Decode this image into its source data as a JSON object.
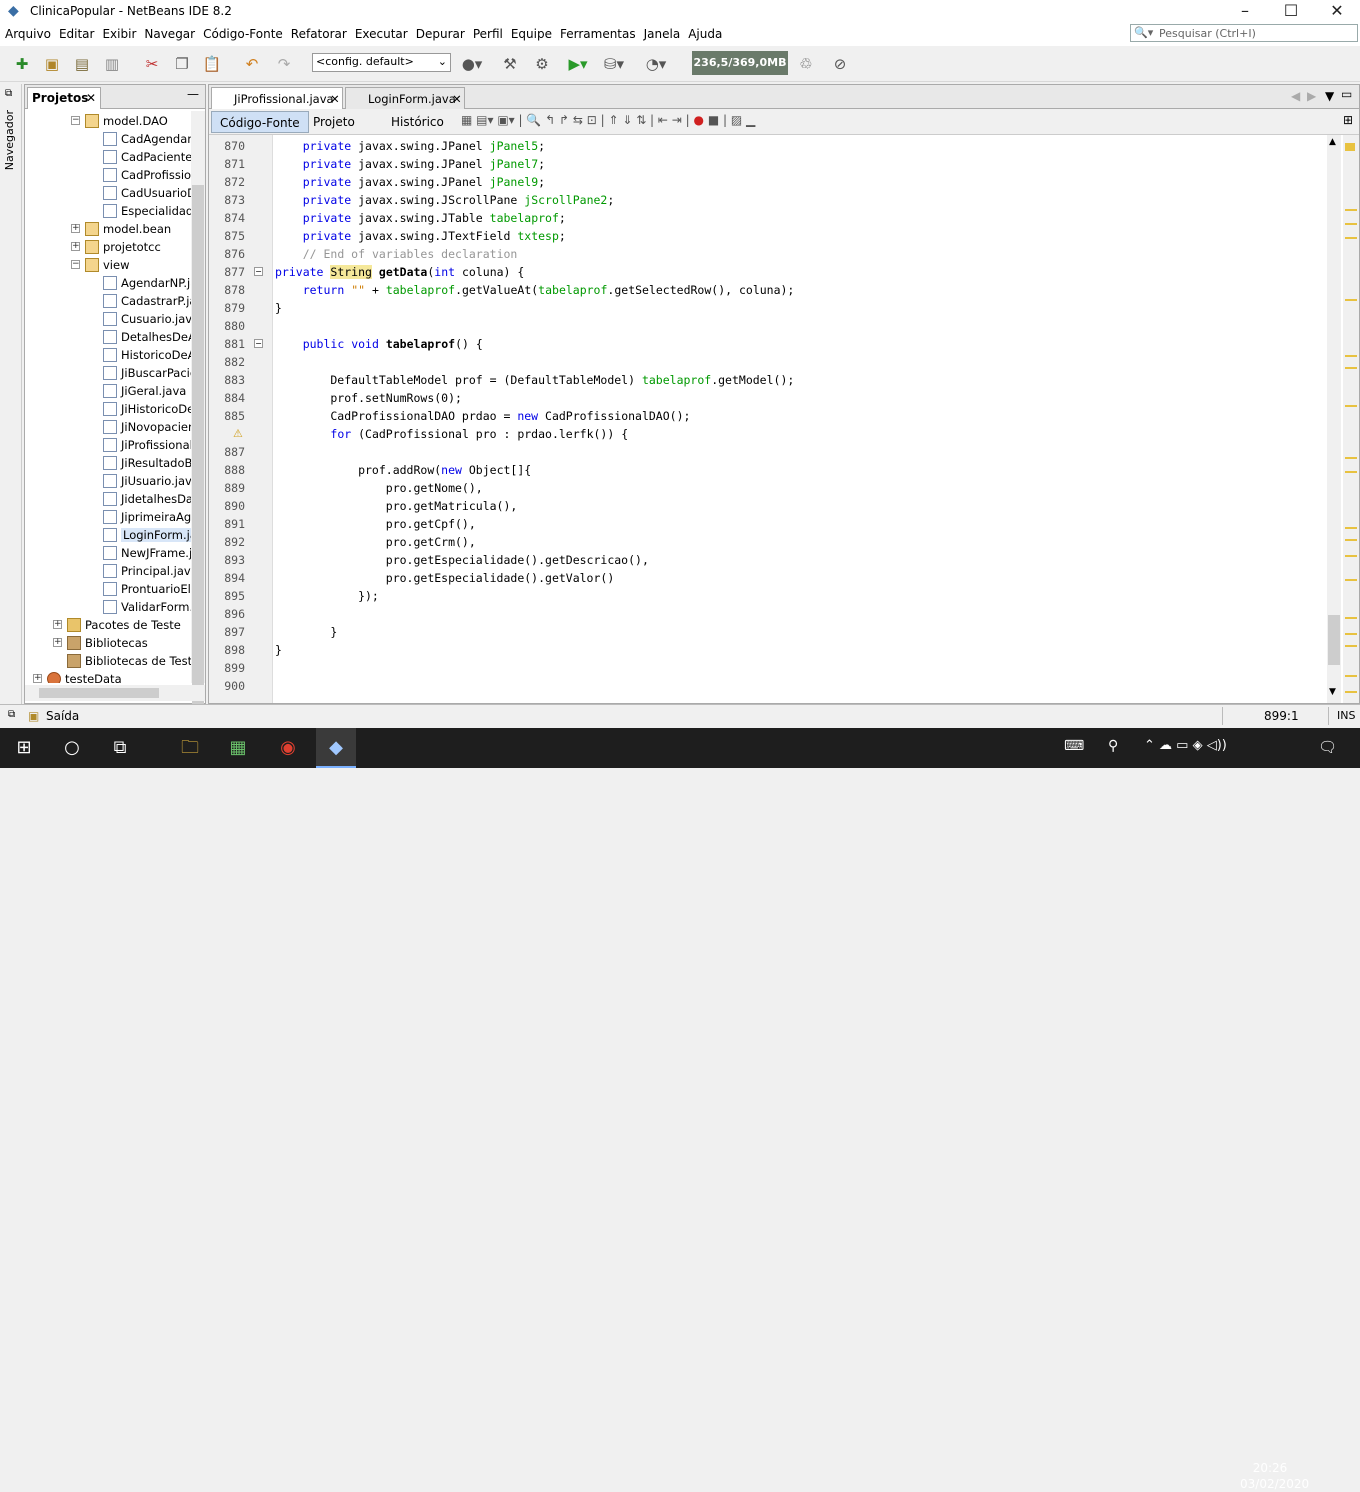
{
  "window": {
    "title": "ClinicaPopular - NetBeans IDE 8.2"
  },
  "menu": [
    "Arquivo",
    "Editar",
    "Exibir",
    "Navegar",
    "Código-Fonte",
    "Refatorar",
    "Executar",
    "Depurar",
    "Perfil",
    "Equipe",
    "Ferramentas",
    "Janela",
    "Ajuda"
  ],
  "search": {
    "placeholder": "Pesquisar (Ctrl+I)"
  },
  "toolbar": {
    "config": "<config. default>",
    "memory": "236,5/369,0MB"
  },
  "navigator": {
    "label": "Navegador"
  },
  "projects": {
    "tab": "Projetos",
    "tree": [
      {
        "label": "model.DAO",
        "icon": "pkg",
        "depth": 2,
        "exp": "-"
      },
      {
        "label": "CadAgendam",
        "icon": "java",
        "depth": 3
      },
      {
        "label": "CadPacienteD",
        "icon": "java",
        "depth": 3
      },
      {
        "label": "CadProfissior",
        "icon": "java",
        "depth": 3
      },
      {
        "label": "CadUsuarioD",
        "icon": "java",
        "depth": 3
      },
      {
        "label": "Especialidade",
        "icon": "java",
        "depth": 3
      },
      {
        "label": "model.bean",
        "icon": "pkg",
        "depth": 2,
        "exp": "+"
      },
      {
        "label": "projetotcc",
        "icon": "pkg",
        "depth": 2,
        "exp": "+"
      },
      {
        "label": "view",
        "icon": "pkg",
        "depth": 2,
        "exp": "-"
      },
      {
        "label": "AgendarNP.ja",
        "icon": "java",
        "depth": 3
      },
      {
        "label": "CadastrarP.ja",
        "icon": "java",
        "depth": 3
      },
      {
        "label": "Cusuario.java",
        "icon": "java",
        "depth": 3
      },
      {
        "label": "DetalhesDeA",
        "icon": "java",
        "depth": 3
      },
      {
        "label": "HistoricoDeA",
        "icon": "java",
        "depth": 3
      },
      {
        "label": "JiBuscarPacie",
        "icon": "java",
        "depth": 3
      },
      {
        "label": "JiGeral.java",
        "icon": "java",
        "depth": 3
      },
      {
        "label": "JiHistoricoDe",
        "icon": "java",
        "depth": 3
      },
      {
        "label": "JiNovopacien",
        "icon": "java",
        "depth": 3
      },
      {
        "label": "JiProfissional",
        "icon": "java",
        "depth": 3
      },
      {
        "label": "JiResultadoBu",
        "icon": "java",
        "depth": 3
      },
      {
        "label": "JiUsuario.jav",
        "icon": "java",
        "depth": 3
      },
      {
        "label": "JidetalhesDa",
        "icon": "java",
        "depth": 3
      },
      {
        "label": "JiprimeiraAge",
        "icon": "java",
        "depth": 3
      },
      {
        "label": "LoginForm.ja",
        "icon": "java",
        "depth": 3,
        "selected": true
      },
      {
        "label": "NewJFrame.j",
        "icon": "java",
        "depth": 3
      },
      {
        "label": "Principal.java",
        "icon": "java",
        "depth": 3
      },
      {
        "label": "ProntuarioEle",
        "icon": "java",
        "depth": 3
      },
      {
        "label": "ValidarForm.j",
        "icon": "java",
        "depth": 3
      },
      {
        "label": "Pacotes de Teste",
        "icon": "folder",
        "depth": 1,
        "exp": "+"
      },
      {
        "label": "Bibliotecas",
        "icon": "lib",
        "depth": 1,
        "exp": "+"
      },
      {
        "label": "Bibliotecas de Testes",
        "icon": "lib",
        "depth": 1
      },
      {
        "label": "testeData",
        "icon": "proj",
        "depth": 0,
        "exp": "+"
      }
    ]
  },
  "editor": {
    "tabs": [
      "JiProfissional.java",
      "LoginForm.java"
    ],
    "views": [
      "Código-Fonte",
      "Projeto",
      "Histórico"
    ],
    "lines": [
      {
        "n": "870",
        "html": "    <span class=\"kw\">private</span> javax.swing.JPanel <span class=\"var\">jPanel5</span>;"
      },
      {
        "n": "871",
        "html": "    <span class=\"kw\">private</span> javax.swing.JPanel <span class=\"var\">jPanel7</span>;"
      },
      {
        "n": "872",
        "html": "    <span class=\"kw\">private</span> javax.swing.JPanel <span class=\"var\">jPanel9</span>;"
      },
      {
        "n": "873",
        "html": "    <span class=\"kw\">private</span> javax.swing.JScrollPane <span class=\"var\">jScrollPane2</span>;"
      },
      {
        "n": "874",
        "html": "    <span class=\"kw\">private</span> javax.swing.JTable <span class=\"var\">tabelaprof</span>;"
      },
      {
        "n": "875",
        "html": "    <span class=\"kw\">private</span> javax.swing.JTextField <span class=\"var\">txtesp</span>;"
      },
      {
        "n": "876",
        "html": "    <span class=\"cm\">// End of variables declaration</span>"
      },
      {
        "n": "877",
        "fold": true,
        "html": "<span class=\"kw\">private</span> <span class=\"hl\">String</span> <b>getData</b>(<span class=\"kw\">int</span> coluna) {"
      },
      {
        "n": "878",
        "html": "    <span class=\"kw\">return</span> <span class=\"str\">\"\"</span> + <span class=\"var\">tabelaprof</span>.getValueAt(<span class=\"var\">tabelaprof</span>.getSelectedRow(), coluna);"
      },
      {
        "n": "879",
        "html": "}"
      },
      {
        "n": "880",
        "html": ""
      },
      {
        "n": "881",
        "fold": true,
        "html": "    <span class=\"kw\">public</span> <span class=\"kw\">void</span> <b>tabelaprof</b>() {"
      },
      {
        "n": "882",
        "html": ""
      },
      {
        "n": "883",
        "html": "        DefaultTableModel prof = (DefaultTableModel) <span class=\"var\">tabelaprof</span>.getModel();"
      },
      {
        "n": "884",
        "html": "        prof.setNumRows(0);"
      },
      {
        "n": "885",
        "html": "        CadProfissionalDAO prdao = <span class=\"kw\">new</span> CadProfissionalDAO();"
      },
      {
        "n": "",
        "warn": true,
        "html": "        <span class=\"kw\">for</span> (CadProfissional pro : prdao.lerfk()) {"
      },
      {
        "n": "887",
        "html": ""
      },
      {
        "n": "888",
        "html": "            prof.addRow(<span class=\"kw\">new</span> Object[]{"
      },
      {
        "n": "889",
        "html": "                pro.getNome(),"
      },
      {
        "n": "890",
        "html": "                pro.getMatricula(),"
      },
      {
        "n": "891",
        "html": "                pro.getCpf(),"
      },
      {
        "n": "892",
        "html": "                pro.getCrm(),"
      },
      {
        "n": "893",
        "html": "                pro.getEspecialidade().getDescricao(),"
      },
      {
        "n": "894",
        "html": "                pro.getEspecialidade().getValor()"
      },
      {
        "n": "895",
        "html": "            });"
      },
      {
        "n": "896",
        "html": ""
      },
      {
        "n": "897",
        "html": "        }"
      },
      {
        "n": "898",
        "html": "}"
      },
      {
        "n": "899",
        "html": ""
      },
      {
        "n": "900",
        "html": ""
      }
    ]
  },
  "status": {
    "output": "Saída",
    "position": "899:1",
    "mode": "INS"
  },
  "taskbar": {
    "time": "20:26",
    "date": "03/02/2020"
  }
}
